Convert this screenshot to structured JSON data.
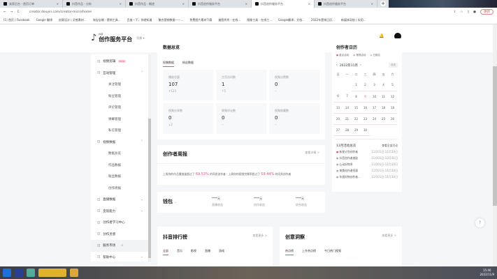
{
  "browser": {
    "tabs": [
      {
        "label": "卖家后台 - 首页订单"
      },
      {
        "label": "抖音作品 - 分析"
      },
      {
        "label": "抖音作品 - 概述"
      },
      {
        "label": "抖音创作服务平台"
      },
      {
        "label": "抖音创作服务平台",
        "active": true
      },
      {
        "label": "抖音创作服务平台"
      }
    ],
    "url": "creator.douyin.com/creator-micro/home",
    "update_label": "更新",
    "bookmarks": [
      "(1) 首页 | Facebook",
      "Google 翻译",
      "创意设计 | 灵感素材...",
      "淘宝店铺 - 营销工具...",
      "百度一下，你就知道",
      "聚合营销数据——...",
      "免费图片素材下载",
      "美图秀秀 - 在线...",
      "图像工具 - 在线工...",
      "Google翻译，文档...",
      "2022年营销日历...",
      "新媒体导航 | 实用..."
    ]
  },
  "header": {
    "logo_small": "抖音",
    "title": "创作服务平台",
    "switch_label": "切换"
  },
  "sidebar": {
    "items": [
      {
        "label": "视频剪辑",
        "badge": "NEW"
      },
      {
        "label": "互动管理",
        "chevron": "^"
      },
      {
        "label": "关注管理",
        "sub": true
      },
      {
        "label": "粉丝管理",
        "sub": true
      },
      {
        "label": "评论管理",
        "sub": true
      },
      {
        "label": "弹幕管理",
        "sub": true
      },
      {
        "label": "私信管理",
        "sub": true
      },
      {
        "label": "视频数据",
        "chevron": "^"
      },
      {
        "label": "数据总览",
        "sub": true
      },
      {
        "label": "作品数据",
        "sub": true
      },
      {
        "label": "粉丝数据",
        "sub": true
      },
      {
        "label": "创作周报",
        "sub": true
      },
      {
        "label": "直播数据",
        "chevron": "v"
      },
      {
        "label": "变现能力",
        "chevron": "v"
      },
      {
        "label": "创作者学习中心"
      },
      {
        "label": "创作灵感"
      },
      {
        "label": "服务市场",
        "active": true
      },
      {
        "label": "帮助中心",
        "chevron": "v"
      }
    ]
  },
  "overview": {
    "title": "数据总览",
    "tabs": [
      "投稿数据",
      "粉丝数据"
    ],
    "stats": [
      {
        "label": "播放总量",
        "value": "107",
        "delta": "↑123"
      },
      {
        "label": "主页访问数",
        "value": "1",
        "delta": "↑5"
      },
      {
        "label": "视频点赞数",
        "value": "0",
        "delta": "--"
      },
      {
        "label": "视频分享数",
        "value": "0",
        "delta": "↓2"
      },
      {
        "label": "视频评论数",
        "value": "0",
        "delta": "--"
      },
      {
        "label": "视频收藏数",
        "value": "0",
        "delta": "--"
      }
    ]
  },
  "weekly": {
    "title": "创作者周报",
    "more": "查看详情 >",
    "text1a": "上周你的作品播放量超过了 ",
    "pct1": "69.53%",
    "text1b": " 的同类创作者",
    "text2a": "上周你的视频完播率超过了 ",
    "pct2": "59.44%",
    "text2b": " 的同类创作者"
  },
  "wallet": {
    "title": "钱包",
    "items": [
      {
        "value": "****元",
        "label": "直播收益"
      },
      {
        "value": "****元",
        "label": "创作收益"
      },
      {
        "value": "****元",
        "label": "综合收益"
      }
    ]
  },
  "rank": {
    "title": "抖音排行榜",
    "more": "查看更多 >",
    "tabs": [
      "全部",
      "音乐",
      "影视",
      "直播",
      "游戏"
    ]
  },
  "insight": {
    "title": "创意洞察",
    "more": "查看更多 >",
    "tabs": [
      "热点榜",
      "上升热点榜",
      "今日热门视频"
    ]
  },
  "calendar": {
    "title": "创作者日历",
    "legend": [
      "重点活动",
      "常规活动",
      "已报名"
    ],
    "month": "2022年11月",
    "today_label": "今天",
    "weekdays": [
      "日",
      "一",
      "二",
      "三",
      "四",
      "五",
      "六"
    ],
    "weeks": [
      [
        "",
        "",
        "1",
        "2",
        "3",
        "4",
        "5"
      ],
      [
        "6",
        "7",
        "8",
        "9",
        "10",
        "11",
        "12"
      ],
      [
        "13",
        "14",
        "15",
        "16",
        "17",
        "18",
        "19"
      ],
      [
        "20",
        "21",
        "22",
        "23",
        "24",
        "25",
        "26"
      ],
      [
        "27",
        "28",
        "29",
        "30",
        "",
        "",
        ""
      ]
    ],
    "today": "9",
    "events_title": "11月活动总览",
    "events_more": "查看全部活动",
    "events": [
      {
        "name": "新星计划创作者",
        "date": "11月01日-11月30日"
      },
      {
        "name": "抖音创作者激励",
        "date": "11月01日-12月31日"
      },
      {
        "name": "心动好物季",
        "date": "11月01日-11月30日"
      },
      {
        "name": "美食创作者招募",
        "date": "11月01日-11月30日"
      },
      {
        "name": "年度好物创作者...",
        "date": "11月01日-11月30日"
      }
    ]
  },
  "taskbar": {
    "time": "15:46",
    "date": "2022/11/9"
  },
  "colors": {
    "accent": "#e5527a"
  }
}
